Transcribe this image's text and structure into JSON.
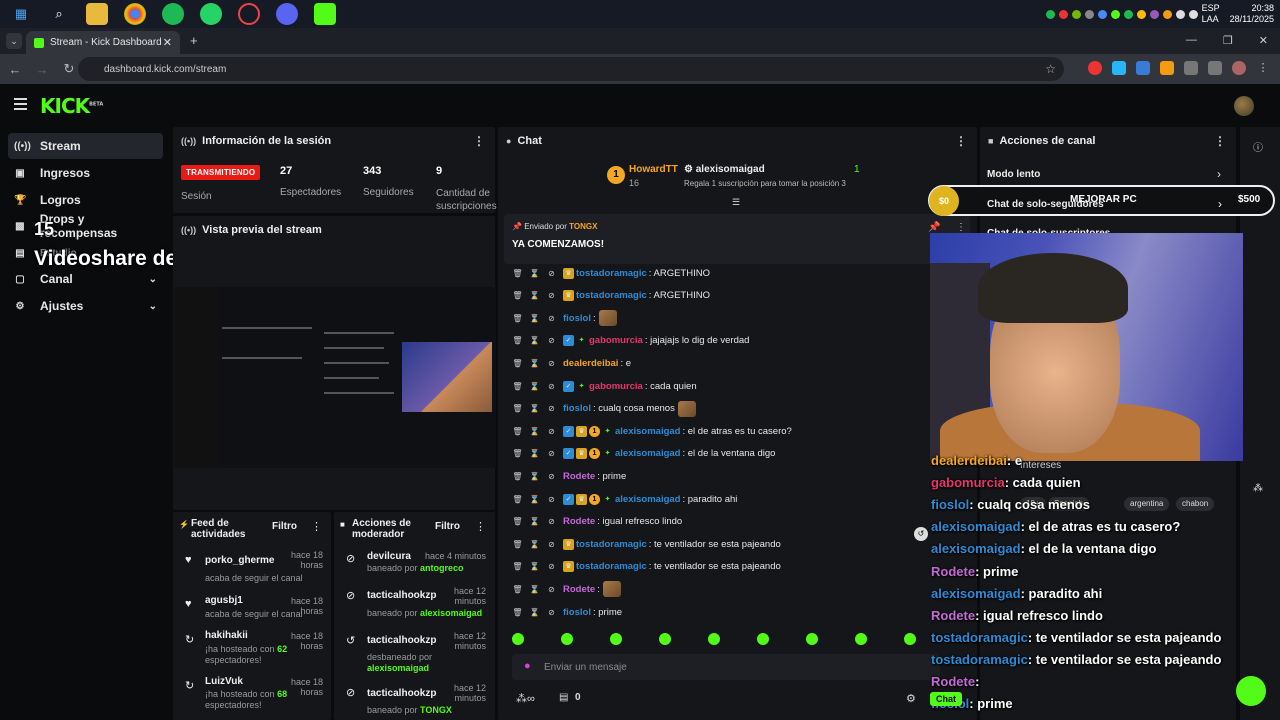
{
  "os": {
    "lang": "ESP",
    "lang2": "LAA",
    "time": "20:38",
    "date": "28/11/2025"
  },
  "browser": {
    "tab_title": "Stream - Kick Dashboard",
    "url": "dashboard.kick.com/stream"
  },
  "brand": {
    "logo": "KICK",
    "beta": "BETA",
    "accent": "#53fc18"
  },
  "sidebar": {
    "items": [
      {
        "label": "Stream",
        "icon": "broadcast-icon"
      },
      {
        "label": "Ingresos",
        "icon": "dollar-icon"
      },
      {
        "label": "Logros",
        "icon": "trophy-icon"
      },
      {
        "label": "Drops y recompensas",
        "icon": "gift-icon"
      },
      {
        "label": "Estudio",
        "icon": "studio-icon"
      },
      {
        "label": "Canal",
        "icon": "channel-icon"
      },
      {
        "label": "Ajustes",
        "icon": "gear-icon"
      }
    ],
    "overlay_number": "15",
    "overlay_text": "Videoshare de:"
  },
  "session": {
    "title": "Información de la sesión",
    "live_label": "TRANSMITIENDO",
    "session_label": "Sesión",
    "viewers": "27",
    "viewers_label": "Espectadores",
    "followers": "343",
    "followers_label": "Seguidores",
    "subs": "9",
    "subs_label": "Cantidad de suscripciones"
  },
  "preview": {
    "title": "Vista previa del stream"
  },
  "activity": {
    "title": "Feed de actividades",
    "filter": "Filtro",
    "items": [
      {
        "name": "porko_gherme",
        "time": "hace 18 horas",
        "sub": "acaba de seguir el canal"
      },
      {
        "name": "agusbj1",
        "time": "hace 18 horas",
        "sub": "acaba de seguir el canal"
      },
      {
        "name": "hakihakii",
        "time": "hace 18 horas",
        "sub_a": "¡ha hosteado con ",
        "num": "62",
        "sub_b": "espectadores!"
      },
      {
        "name": "LuizVuk",
        "time": "hace 18 horas",
        "sub_a": "¡ha hosteado con ",
        "num": "68",
        "sub_b": "espectadores!"
      }
    ]
  },
  "modactions": {
    "title": "Acciones de moderador",
    "filter": "Filtro",
    "items": [
      {
        "name": "devilcura",
        "time": "hace 4 minutos",
        "action": "baneado por ",
        "by": "antogreco"
      },
      {
        "name": "tacticalhookzp",
        "time": "hace 12 minutos",
        "action": "baneado por ",
        "by": "alexisomaigad"
      },
      {
        "name": "tacticalhookzp",
        "time": "hace 12 minutos",
        "action": "desbaneado por ",
        "by": "alexisomaigad"
      },
      {
        "name": "tacticalhookzp",
        "time": "hace 12 minutos",
        "action": "baneado por ",
        "by": "TONGX"
      }
    ]
  },
  "chat": {
    "title": "Chat",
    "top_user": "HowardTT",
    "top_user_count": "16",
    "gift_user": "alexisomaigad",
    "gift_count": "1",
    "gift_text": "Regala 1 suscripción para tomar la posición 3",
    "pinned_by_label": "Enviado por",
    "pinned_by": "TONGX",
    "pinned_msg": "YA COMENZAMOS!",
    "input_placeholder": "Enviar un mensaje",
    "viewers_count": "0",
    "messages": [
      {
        "user": "tostadoramagic",
        "color": "#2d8cd6",
        "text": ": ARGETHINO",
        "badges": [
          "crown"
        ]
      },
      {
        "user": "tostadoramagic",
        "color": "#2d8cd6",
        "text": ": ARGETHINO",
        "badges": [
          "crown"
        ]
      },
      {
        "user": "fioslol",
        "color": "#2d8cd6",
        "text": ":",
        "badges": [],
        "emote": true
      },
      {
        "user": "gabomurcia",
        "color": "#e9356a",
        "text": ": jajajajs lo dig de verdad",
        "badges": [
          "verified",
          "gem"
        ]
      },
      {
        "user": "dealerdeibai",
        "color": "#f5a623",
        "text": ": e",
        "badges": []
      },
      {
        "user": "gabomurcia",
        "color": "#e9356a",
        "text": ": cada quien",
        "badges": [
          "verified",
          "gem"
        ]
      },
      {
        "user": "fioslol",
        "color": "#2d8cd6",
        "text": ": cualq cosa menos",
        "badges": [],
        "emote": true
      },
      {
        "user": "alexisomaigad",
        "color": "#2d8cd6",
        "text": ": el de atras es tu casero?",
        "badges": [
          "verified",
          "crown",
          "one",
          "gem"
        ]
      },
      {
        "user": "alexisomaigad",
        "color": "#2d8cd6",
        "text": ": el de la ventana digo",
        "badges": [
          "verified",
          "crown",
          "one",
          "gem"
        ]
      },
      {
        "user": "Rodete",
        "color": "#c46ad8",
        "text": ": prime",
        "badges": []
      },
      {
        "user": "alexisomaigad",
        "color": "#2d8cd6",
        "text": ": paradito ahi",
        "badges": [
          "verified",
          "crown",
          "one",
          "gem"
        ]
      },
      {
        "user": "Rodete",
        "color": "#c46ad8",
        "text": ": igual refresco lindo",
        "badges": []
      },
      {
        "user": "tostadoramagic",
        "color": "#2d8cd6",
        "text": ": te ventilador se esta pajeando",
        "badges": [
          "crown"
        ]
      },
      {
        "user": "tostadoramagic",
        "color": "#2d8cd6",
        "text": ": te ventilador se esta pajeando",
        "badges": [
          "crown"
        ]
      },
      {
        "user": "Rodete",
        "color": "#c46ad8",
        "text": ":",
        "badges": [],
        "emote": true
      },
      {
        "user": "fioslol",
        "color": "#2d8cd6",
        "text": ": prime",
        "badges": []
      }
    ]
  },
  "channel": {
    "title": "Acciones de canal",
    "items": [
      "Modo lento",
      "Chat de solo-seguidores",
      "Chat de solo-suscriptores"
    ],
    "promo": "MEJORAR PC",
    "promo_left": "$0",
    "promo_right": "$500",
    "tags_label": "Intereses",
    "tags": [
      "18+",
      "Spanish",
      "argentina",
      "chabon"
    ]
  },
  "overlay_chat": [
    {
      "user": "dealerdeibai",
      "color": "#f5a623",
      "text": ": e"
    },
    {
      "user": "gabomurcia",
      "color": "#e9356a",
      "text": ": cada quien"
    },
    {
      "user": "fioslol",
      "color": "#2d8cd6",
      "text": ": cualq cosa menos"
    },
    {
      "user": "alexisomaigad",
      "color": "#2d8cd6",
      "text": ": el de atras es tu casero?"
    },
    {
      "user": "alexisomaigad",
      "color": "#2d8cd6",
      "text": ": el de la ventana digo"
    },
    {
      "user": "Rodete",
      "color": "#c46ad8",
      "text": ": prime"
    },
    {
      "user": "alexisomaigad",
      "color": "#2d8cd6",
      "text": ": paradito ahi"
    },
    {
      "user": "Rodete",
      "color": "#c46ad8",
      "text": ": igual refresco lindo"
    },
    {
      "user": "tostadoramagic",
      "color": "#2d8cd6",
      "text": ": te ventilador se esta pajeando"
    },
    {
      "user": "tostadoramagic",
      "color": "#2d8cd6",
      "text": ": te ventilador se esta pajeando"
    },
    {
      "user": "Rodete",
      "color": "#c46ad8",
      "text": ":"
    },
    {
      "user": "fioslol",
      "color": "#2d8cd6",
      "text": ": prime"
    }
  ],
  "overlay_chat_pill": "Chat"
}
